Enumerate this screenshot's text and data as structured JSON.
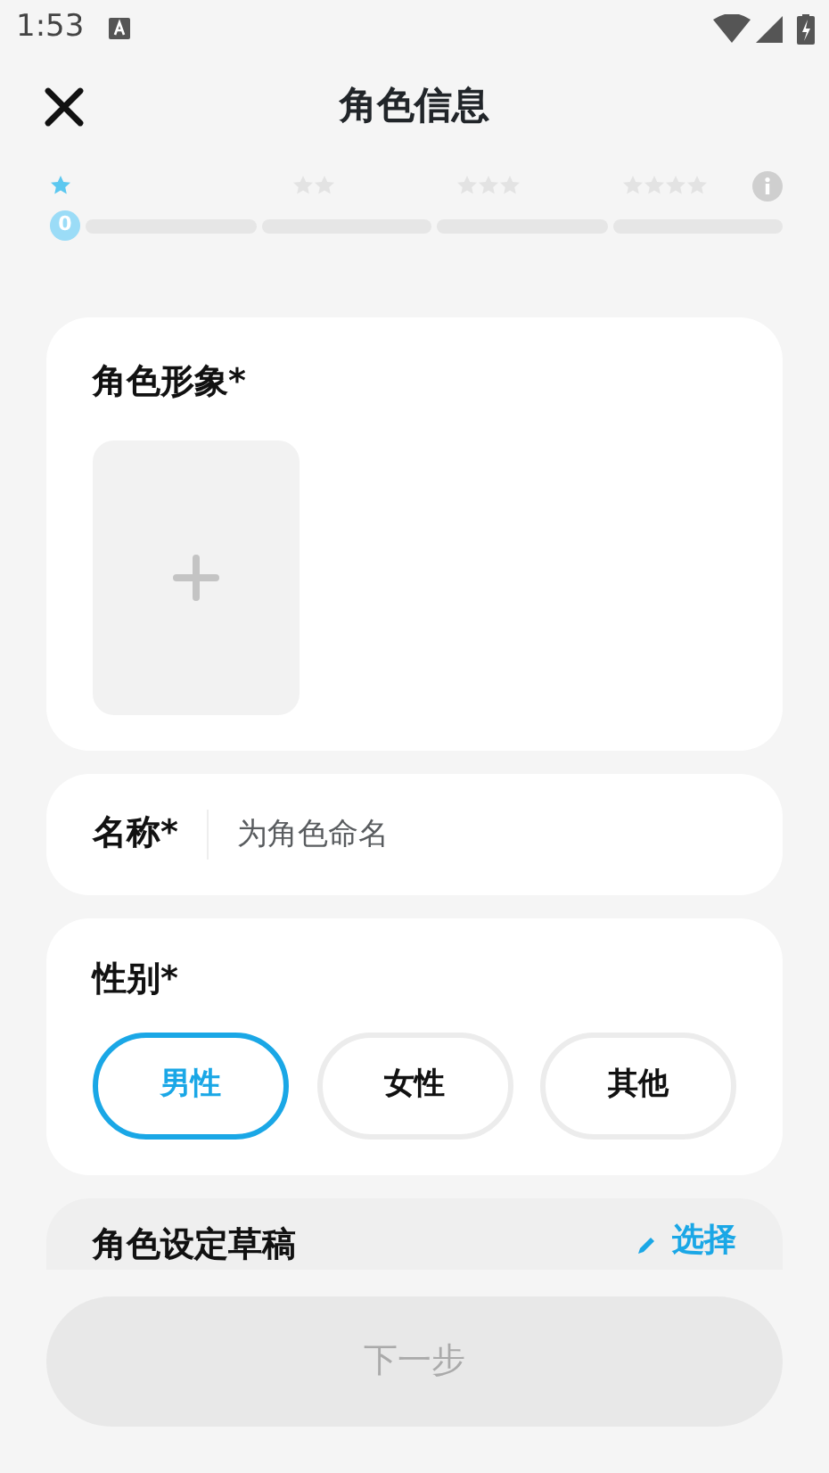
{
  "status_bar": {
    "time": "1:53"
  },
  "header": {
    "title": "角色信息"
  },
  "progress": {
    "count": "0",
    "steps": [
      {
        "reached": true,
        "level": 0
      },
      {
        "reached": false,
        "level": 0
      },
      {
        "reached": false,
        "level": 0
      },
      {
        "reached": false,
        "level": 0
      }
    ]
  },
  "image_card": {
    "label": "角色形象*"
  },
  "name_card": {
    "label": "名称*",
    "placeholder": "为角色命名"
  },
  "gender_card": {
    "label": "性别*",
    "options": [
      {
        "label": "男性",
        "selected": true
      },
      {
        "label": "女性",
        "selected": false
      },
      {
        "label": "其他",
        "selected": false
      }
    ]
  },
  "draft_card": {
    "label": "角色设定草稿",
    "action": "选择"
  },
  "next_button": {
    "label": "下一步",
    "disabled": true
  }
}
